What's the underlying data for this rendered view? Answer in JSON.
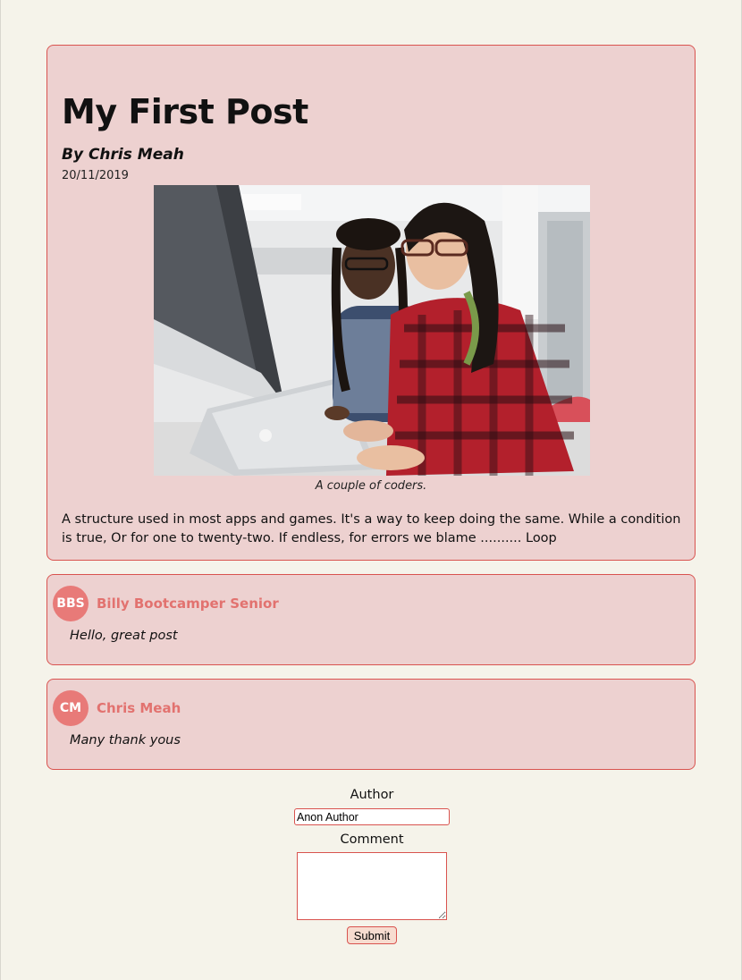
{
  "post": {
    "title": "My First Post",
    "author_line": "By Chris Meah",
    "date": "20/11/2019",
    "image_caption": "A couple of coders.",
    "body": "A structure used in most apps and games. It's a way to keep doing the same. While a condition is true, Or for one to twenty-two. If endless, for errors we blame .......... Loop"
  },
  "comments": [
    {
      "initials": "BBS",
      "author": "Billy Bootcamper Senior",
      "text": "Hello, great post"
    },
    {
      "initials": "CM",
      "author": "Chris Meah",
      "text": "Many thank yous"
    }
  ],
  "form": {
    "author_label": "Author",
    "author_value": "Anon Author",
    "comment_label": "Comment",
    "comment_value": "",
    "submit_label": "Submit"
  },
  "colors": {
    "page_bg": "#f5f3ea",
    "card_bg": "#edd1d0",
    "card_border": "#d9534f",
    "accent": "#e87a78"
  }
}
